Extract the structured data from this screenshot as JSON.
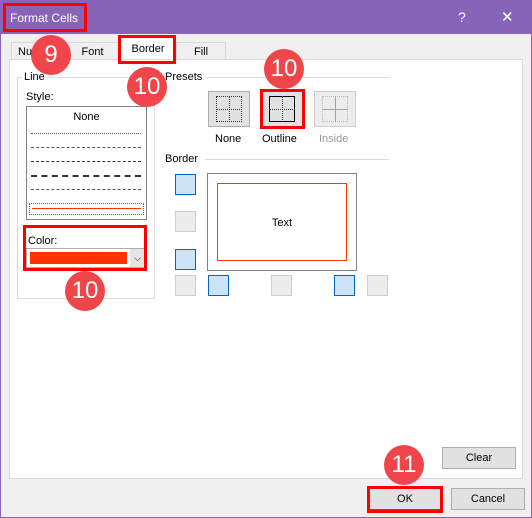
{
  "dialog": {
    "title": "Format Cells",
    "help": "?",
    "close": "✕"
  },
  "tabs": [
    {
      "label": "Nu"
    },
    {
      "label": "Font"
    },
    {
      "label": "Border"
    },
    {
      "label": "Fill"
    }
  ],
  "line": {
    "group": "Line",
    "style_label": "Style:",
    "none": "None",
    "color_label": "Color:",
    "color": "#ff3300"
  },
  "presets": {
    "group": "Presets",
    "items": [
      {
        "label": "None"
      },
      {
        "label": "Outline"
      },
      {
        "label": "Inside"
      }
    ]
  },
  "border": {
    "group": "Border",
    "preview_text": "Text"
  },
  "buttons": {
    "clear": "Clear",
    "ok": "OK",
    "cancel": "Cancel"
  },
  "badges": [
    "9",
    "10",
    "10",
    "10",
    "11"
  ],
  "colors": {
    "title_bar": "#8764b8",
    "highlight": "#ff0000",
    "badge": "#f0454a"
  }
}
